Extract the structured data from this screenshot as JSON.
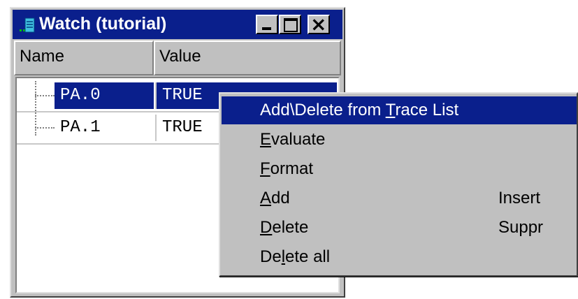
{
  "window": {
    "title": "Watch (tutorial)",
    "accent_color": "#0a1f8c",
    "icons": [
      "app-icon",
      "minimize-icon",
      "maximize-icon",
      "close-icon"
    ]
  },
  "columns": {
    "name": "Name",
    "value": "Value"
  },
  "rows": [
    {
      "name": "PA.0",
      "value": "TRUE",
      "selected": true
    },
    {
      "name": "PA.1",
      "value": "TRUE",
      "selected": false
    }
  ],
  "context_menu": {
    "items": [
      {
        "pre": "Add\\Delete from ",
        "ul": "T",
        "post": "race List",
        "shortcut": "",
        "highlighted": true
      },
      {
        "pre": "",
        "ul": "E",
        "post": "valuate",
        "shortcut": ""
      },
      {
        "pre": "",
        "ul": "F",
        "post": "ormat",
        "shortcut": ""
      },
      {
        "pre": "",
        "ul": "A",
        "post": "dd",
        "shortcut": "Insert"
      },
      {
        "pre": "",
        "ul": "D",
        "post": "elete",
        "shortcut": "Suppr"
      },
      {
        "pre": "De",
        "ul": "l",
        "post": "ete all",
        "shortcut": ""
      }
    ]
  }
}
